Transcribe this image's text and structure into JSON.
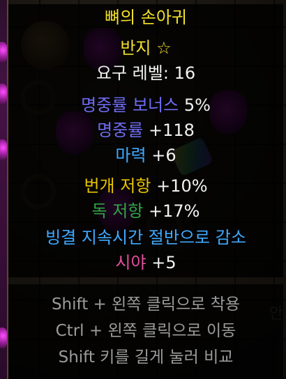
{
  "item": {
    "name": "뼈의 손아귀",
    "type": "반지 ☆",
    "requirement": {
      "label": "요구 레벨:",
      "value": "16"
    },
    "mods": [
      {
        "label": "명중률 보너스",
        "value": "5%",
        "color": "#6f6cf5"
      },
      {
        "label": "명중률",
        "value": "+118",
        "color": "#6f6cf5"
      },
      {
        "label": "마력",
        "value": "+6",
        "color": "#3fa9ff"
      },
      {
        "label": "번개 저항",
        "value": "+10%",
        "color": "#e8c300"
      },
      {
        "label": "독 저항",
        "value": "+17%",
        "color": "#2fa544"
      },
      {
        "label": "빙결 지속시간 절반으로 감소",
        "value": "",
        "color": "#3fa9ff"
      },
      {
        "label": "시야",
        "value": "+5",
        "color": "#e34f9c"
      }
    ],
    "name_color": "#f2e12a"
  },
  "hints": [
    "Shift + 왼쪽 클릭으로 착용",
    "Ctrl + 왼쪽 클릭으로 이동",
    "Shift 키를 길게 눌러 비교"
  ],
  "background": {
    "fragment_text": "안"
  }
}
